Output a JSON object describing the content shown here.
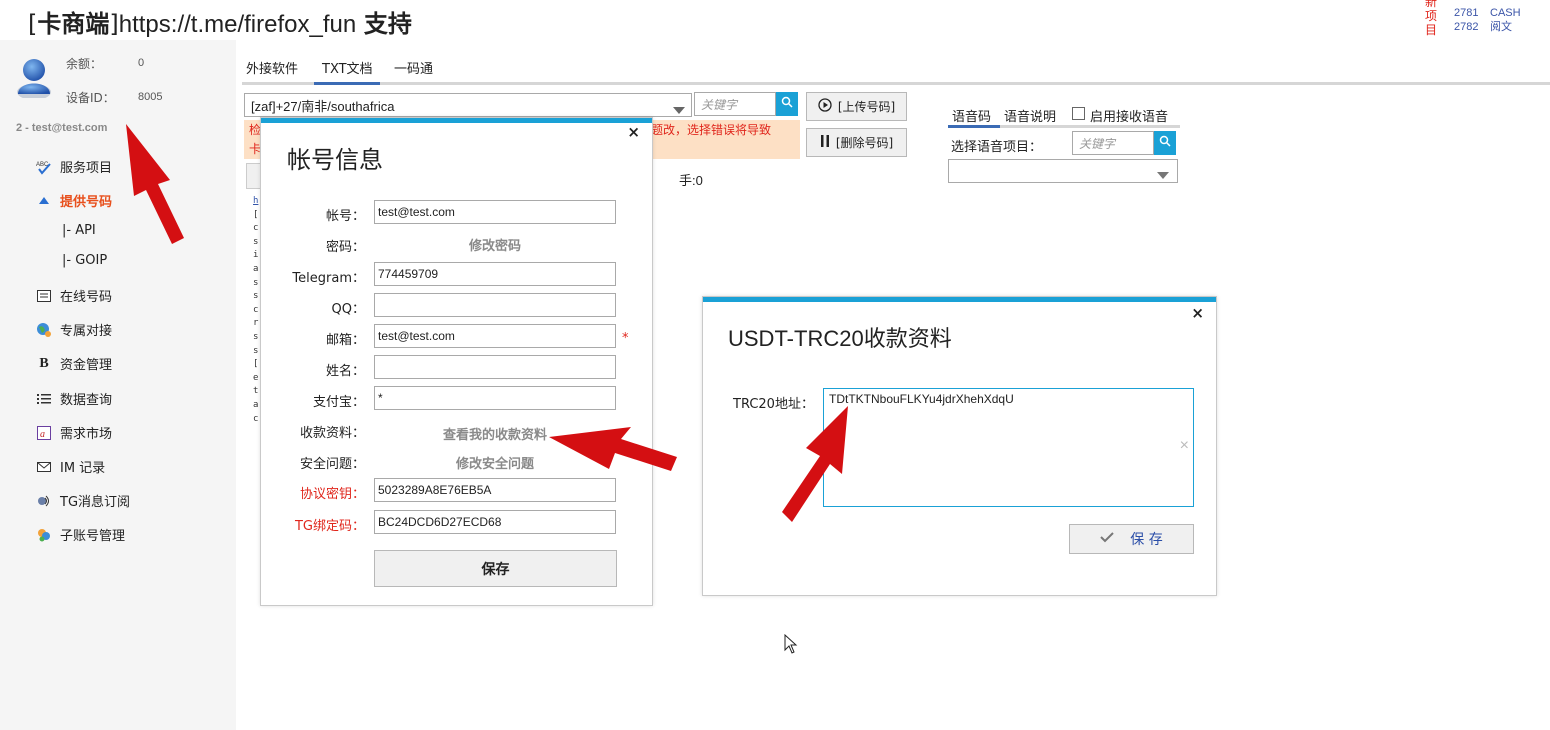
{
  "header": {
    "title_bracket_open": "[",
    "title_brand": "卡商端",
    "title_bracket_close": "]",
    "title_url": "https://t.me/firefox_fun",
    "title_support": "支持",
    "stats": {
      "vertical_label": [
        "新",
        "项",
        "目"
      ],
      "numbers": [
        "2781",
        "2782"
      ],
      "labels": [
        "CASH",
        "阅文"
      ]
    }
  },
  "user": {
    "balance_label": "余额：",
    "balance_value": "0",
    "device_label": "设备ID：",
    "device_value": "8005",
    "account_line": "2 - test@test.com"
  },
  "sidebar": {
    "items": [
      {
        "label": "服务项目",
        "icon": "abc-check-icon"
      },
      {
        "label": "提供号码",
        "icon": "up-arrow-icon",
        "active": true
      },
      {
        "label": "|- API",
        "sub": true
      },
      {
        "label": "|- GOIP",
        "sub": true
      },
      {
        "label": "在线号码",
        "icon": "list-card-icon"
      },
      {
        "label": "专属对接",
        "icon": "globe-icon"
      },
      {
        "label": "资金管理",
        "icon": "bold-b-icon"
      },
      {
        "label": "数据查询",
        "icon": "list-icon"
      },
      {
        "label": "需求市场",
        "icon": "image-icon"
      },
      {
        "label": "IM 记录",
        "icon": "mail-icon"
      },
      {
        "label": "TG消息订阅",
        "icon": "feed-icon"
      },
      {
        "label": "子账号管理",
        "icon": "users-icon"
      }
    ]
  },
  "tabs": [
    "外接软件",
    "TXT文档",
    "一码通"
  ],
  "toolbar": {
    "country_select": "[zaf]+27/南非/southafrica",
    "keyword_placeholder": "关键字",
    "upload_label": "[上传号码]",
    "delete_label": "[删除号码]",
    "warning_left": "检",
    "warning_left2": "卡",
    "warning_right": "题改，选择错误将导致",
    "count_text": "手:0"
  },
  "voice": {
    "tab_voice_code": "语音码",
    "tab_voice_desc": "语音说明",
    "enable_label": "启用接收语音",
    "select_label": "选择语音项目：",
    "keyword_placeholder": "关键字"
  },
  "log_lines": [
    "h",
    "[",
    "c",
    "s",
    "i",
    "a",
    "s",
    "s",
    "c",
    "r",
    "s",
    "s",
    "[",
    "e",
    "t",
    "a",
    "c"
  ],
  "account_dialog": {
    "title": "帐号信息",
    "close": "×",
    "fields": {
      "account_label": "帐号：",
      "account_value": "test@test.com",
      "password_label": "密码：",
      "password_link": "修改密码",
      "telegram_label": "Telegram：",
      "telegram_value": "774459709",
      "qq_label": "QQ：",
      "qq_value": "",
      "email_label": "邮箱：",
      "email_value": "test@test.com",
      "required_mark": "*",
      "name_label": "姓名：",
      "name_value": "",
      "alipay_label": "支付宝：",
      "alipay_value": "*",
      "payment_label": "收款资料：",
      "payment_link": "查看我的收款资料",
      "security_label": "安全问题：",
      "security_link": "修改安全问题",
      "protocol_label": "协议密钥：",
      "protocol_value": "5023289A8E76EB5A",
      "tg_label": "TG绑定码：",
      "tg_value": "BC24DCD6D27ECD68"
    },
    "save_label": "保存"
  },
  "usdt_dialog": {
    "title_latin": "USDT-TRC20",
    "title_cjk": "收款资料",
    "close": "×",
    "address_label": "TRC20地址：",
    "address_value": "TDtTKTNbouFLKYu4jdrXhehXdqU",
    "clear_icon": "×",
    "save_label": "保 存"
  },
  "colors": {
    "accent": "#1aa1d6",
    "active_nav": "#e8501d",
    "warning_bg": "#fde0c5",
    "warning_text": "#e0261c",
    "arrow": "#d40f12"
  }
}
